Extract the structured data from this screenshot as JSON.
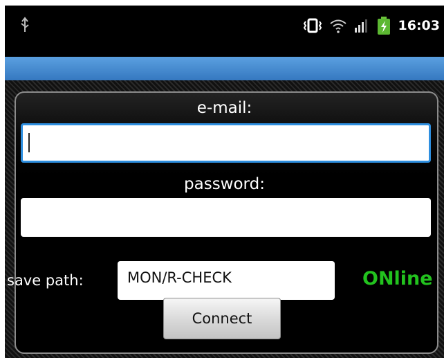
{
  "status_bar": {
    "time": "16:03",
    "icons": [
      "usb-icon",
      "vibrate-icon",
      "wifi-icon",
      "signal-icon",
      "battery-charging-icon"
    ]
  },
  "login_form": {
    "email_label": "e-mail:",
    "email_value": "",
    "password_label": "password:",
    "password_value": "",
    "save_path_label": "save path:",
    "save_path_value": "MON/R-CHECK",
    "status_text": "ONline",
    "connect_label": "Connect"
  },
  "colors": {
    "title_strip": "#4a8fd4",
    "online_status": "#22c21e",
    "focus_border": "#2e8fe0"
  }
}
